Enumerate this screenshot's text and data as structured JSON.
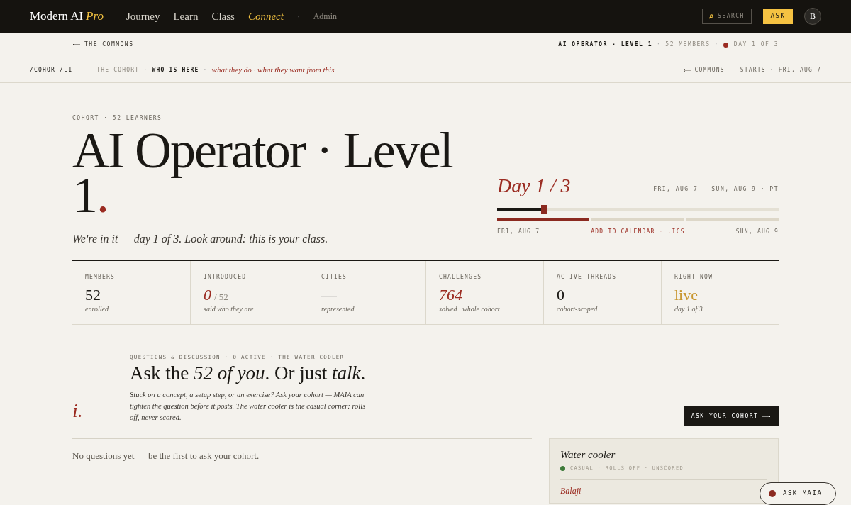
{
  "topbar": {
    "brand": "Modern AI",
    "brand_accent": "Pro",
    "nav": [
      {
        "label": "Journey",
        "selected": false
      },
      {
        "label": "Learn",
        "selected": false
      },
      {
        "label": "Class",
        "selected": false
      },
      {
        "label": "Connect",
        "selected": true
      }
    ],
    "separator": "·",
    "admin": "Admin",
    "search": {
      "placeholder": "SEARCH"
    },
    "ask_button": "ASK",
    "avatar": "B"
  },
  "breadcrumb": {
    "back": "THE COMMONS",
    "course": "AI OPERATOR · LEVEL 1",
    "members": "52 MEMBERS",
    "status": {
      "color": "#9b2c22"
    },
    "day": "DAY 1 OF 3",
    "separator": "·"
  },
  "subnav": {
    "path": "/COHORT/L1",
    "section": "THE COHORT",
    "current": "WHO IS HERE",
    "note": "what they do · what they want from this",
    "back": "COMMONS",
    "starts": "STARTS · FRI, AUG 7",
    "separator": "·"
  },
  "hero": {
    "eyebrow": "COHORT · 52 LEARNERS",
    "title": "AI Operator · Level 1",
    "title_mark": ".",
    "subtitle": "We're in it — *day 1 of 3*. Look around: this is your class.",
    "day_label": "Day 1 / 3",
    "date_range": "FRI, AUG 7 – SUN, AUG 9 · PT",
    "progress": {
      "level": 0.165
    },
    "segments": [
      {
        "selected": true
      },
      {
        "selected": false
      },
      {
        "selected": false
      }
    ],
    "start_label": "FRI, AUG 7",
    "calendar_link": "ADD TO CALENDAR · .ICS",
    "end_label": "SUN, AUG 9"
  },
  "stats": [
    {
      "label": "MEMBERS",
      "value": "52",
      "note": "enrolled"
    },
    {
      "label": "INTRODUCED",
      "value": "0",
      "suffix": "/ 52",
      "color": "#9b2c22",
      "note": "said who they are"
    },
    {
      "label": "CITIES",
      "value": "—",
      "note": "represented"
    },
    {
      "label": "CHALLENGES",
      "value": "764",
      "color": "#9b2c22",
      "note": "solved · whole cohort"
    },
    {
      "label": "ACTIVE THREADS",
      "value": "0",
      "note": "cohort-scoped"
    },
    {
      "label": "RIGHT NOW",
      "value": "live",
      "color": "#c8962e",
      "note": "day 1 of 3"
    }
  ],
  "discussion": {
    "marker": "i.",
    "eyebrow": "QUESTIONS & DISCUSSION · 0 ACTIVE · THE WATER COOLER",
    "heading": "Ask the *52 of you*. Or just *talk*.",
    "body": "Stuck on a concept, a setup step, or an exercise? Ask your cohort — MAIA can tighten the question before it posts. The water cooler is the casual corner: rolls off, never scored.",
    "button": "ASK YOUR COHORT",
    "empty": "No questions yet — be the first to ask your cohort."
  },
  "water_cooler": {
    "title": "Water cooler",
    "status": {
      "color": "#3e7a3a"
    },
    "tags": "CASUAL · ROLLS OFF · UNSCORED",
    "first_author": "Balaji"
  },
  "maia_button": "ASK MAIA"
}
